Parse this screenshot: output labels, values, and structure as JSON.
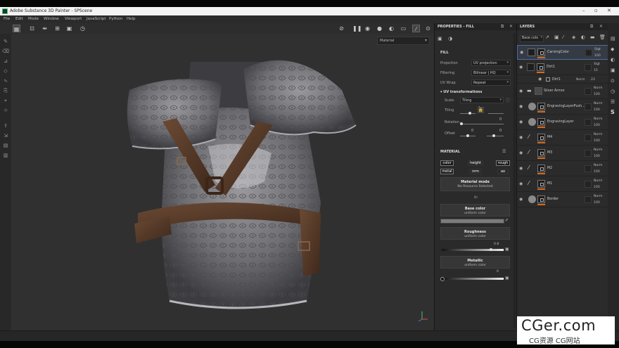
{
  "window": {
    "title": "Adobe Substance 3D Painter - SPScene"
  },
  "menu": [
    "File",
    "Edit",
    "Mode",
    "Window",
    "Viewport",
    "JavaScript",
    "Python",
    "Help"
  ],
  "viewport": {
    "material_mode": "Material"
  },
  "properties": {
    "header": "PROPERTIES - FILL",
    "fill_title": "FILL",
    "projection_label": "Projection",
    "projection_value": "UV projection",
    "filtering_label": "Filtering",
    "filtering_value": "Bilinear | HQ",
    "uvwrap_label": "UV Wrap",
    "uvwrap_value": "Repeat",
    "uv_transformations": "UV transformations",
    "scale_label": "Scale",
    "scale_value": "Tiling",
    "tiling_label": "Tiling",
    "tiling_value": "1",
    "rotation_label": "Rotation",
    "rotation_value": "0",
    "offset_label": "Offset",
    "offset_x": "0",
    "offset_y": "0",
    "material_title": "MATERIAL",
    "channels": [
      "color",
      "height",
      "rough",
      "metal",
      "nrm",
      "ao"
    ],
    "material_mode_title": "Material mode",
    "material_mode_sub": "No Resource Selected",
    "or_text": "Or",
    "base_color_title": "Base color",
    "base_color_sub": "uniform color",
    "roughness_title": "Roughness",
    "roughness_sub": "uniform color",
    "roughness_value": "0.8",
    "metallic_title": "Metallic",
    "metallic_sub": "uniform color",
    "metallic_value": "0"
  },
  "layers": {
    "header": "LAYERS",
    "blend_select": "Base colo",
    "items": [
      {
        "name": "CarvingColor",
        "blend": "Slgt",
        "opacity": "100"
      },
      {
        "name": "Dirt1",
        "blend": "Slgt",
        "opacity": "15"
      },
      {
        "name": "Dirt1",
        "blend": "Norm",
        "opacity": "23"
      },
      {
        "name": "Silver Armor",
        "blend": "Norm",
        "opacity": "100"
      },
      {
        "name": "EngravingLayerPush...",
        "blend": "Norm",
        "opacity": "100"
      },
      {
        "name": "EngravingLayer",
        "blend": "Norm",
        "opacity": "100"
      },
      {
        "name": "M4",
        "blend": "Norm",
        "opacity": "100"
      },
      {
        "name": "M3",
        "blend": "Norm",
        "opacity": "100"
      },
      {
        "name": "M2",
        "blend": "Norm",
        "opacity": "100"
      },
      {
        "name": "M1",
        "blend": "Norm",
        "opacity": "100"
      },
      {
        "name": "Border",
        "blend": "Norm",
        "opacity": "100"
      }
    ]
  },
  "watermark": {
    "line1": "CGer.com",
    "line2": "CG资源 CG网站"
  },
  "colors": {
    "accent": "#d56b1e",
    "selection": "#4f6fa0"
  }
}
